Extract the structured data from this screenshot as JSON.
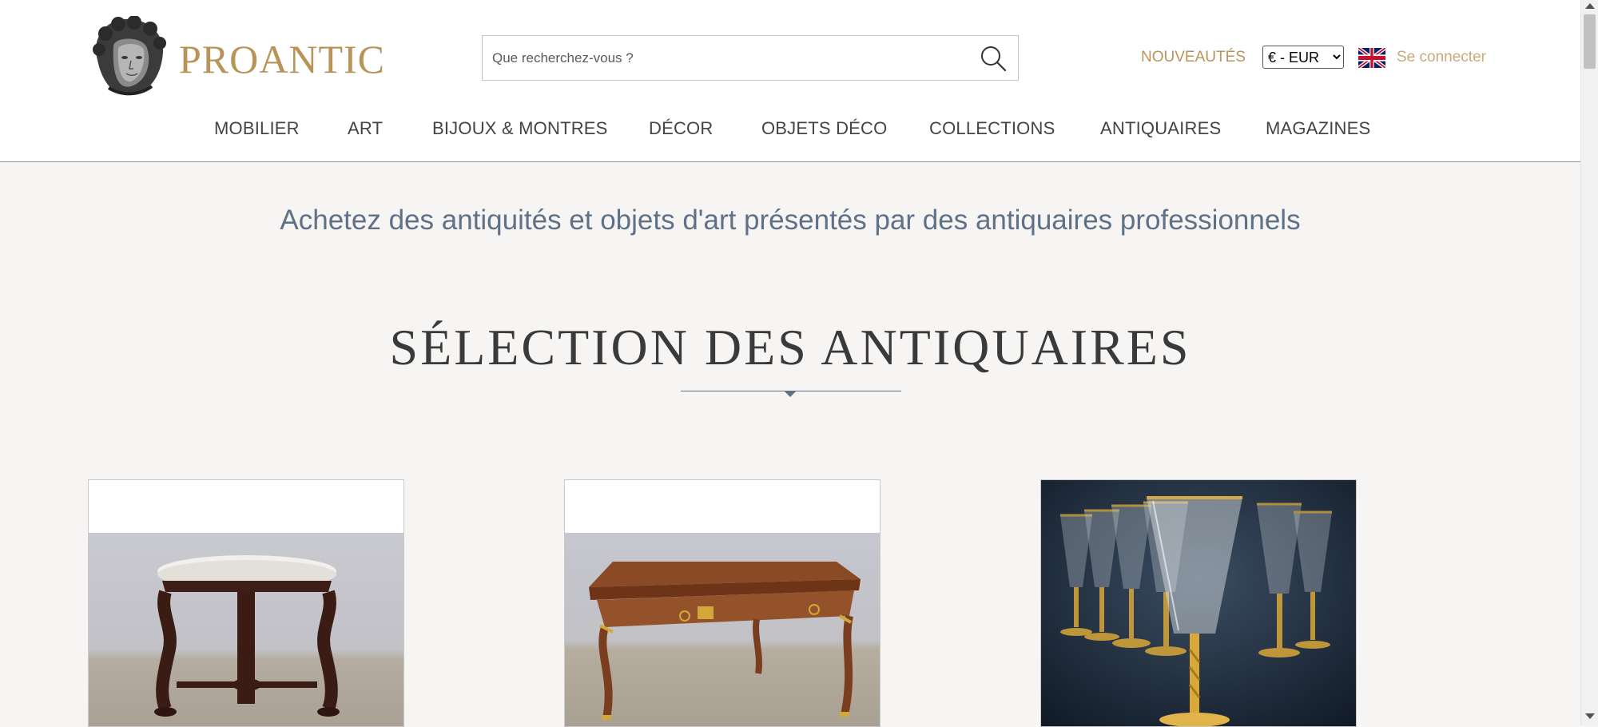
{
  "header": {
    "brand": "PROANTIC",
    "logo_icon": "cherub-head-logo-icon",
    "search": {
      "placeholder": "Que recherchez-vous ?",
      "icon": "search-icon"
    },
    "new_items": "NOUVEAUTÉS",
    "currency": {
      "selected": "€ - EUR"
    },
    "language_icon": "uk-flag-icon",
    "login": "Se connecter"
  },
  "nav": {
    "items": [
      "MOBILIER",
      "ART",
      "BIJOUX & MONTRES",
      "DÉCOR",
      "OBJETS DÉCO",
      "COLLECTIONS",
      "ANTIQUAIRES",
      "MAGAZINES"
    ]
  },
  "main": {
    "tagline": "Achetez des antiquités et objets d'art présentés par des antiquaires professionnels",
    "section_title": "SÉLECTION DES ANTIQUAIRES",
    "cards": [
      {
        "image": "round-marble-top-pedestal-table"
      },
      {
        "image": "louis-xv-style-writing-desk"
      },
      {
        "image": "gold-rimmed-crystal-flutes"
      }
    ]
  },
  "colors": {
    "brand_gold": "#b89459",
    "text_blue_gray": "#5f7187",
    "background": "#f6f5f4"
  }
}
